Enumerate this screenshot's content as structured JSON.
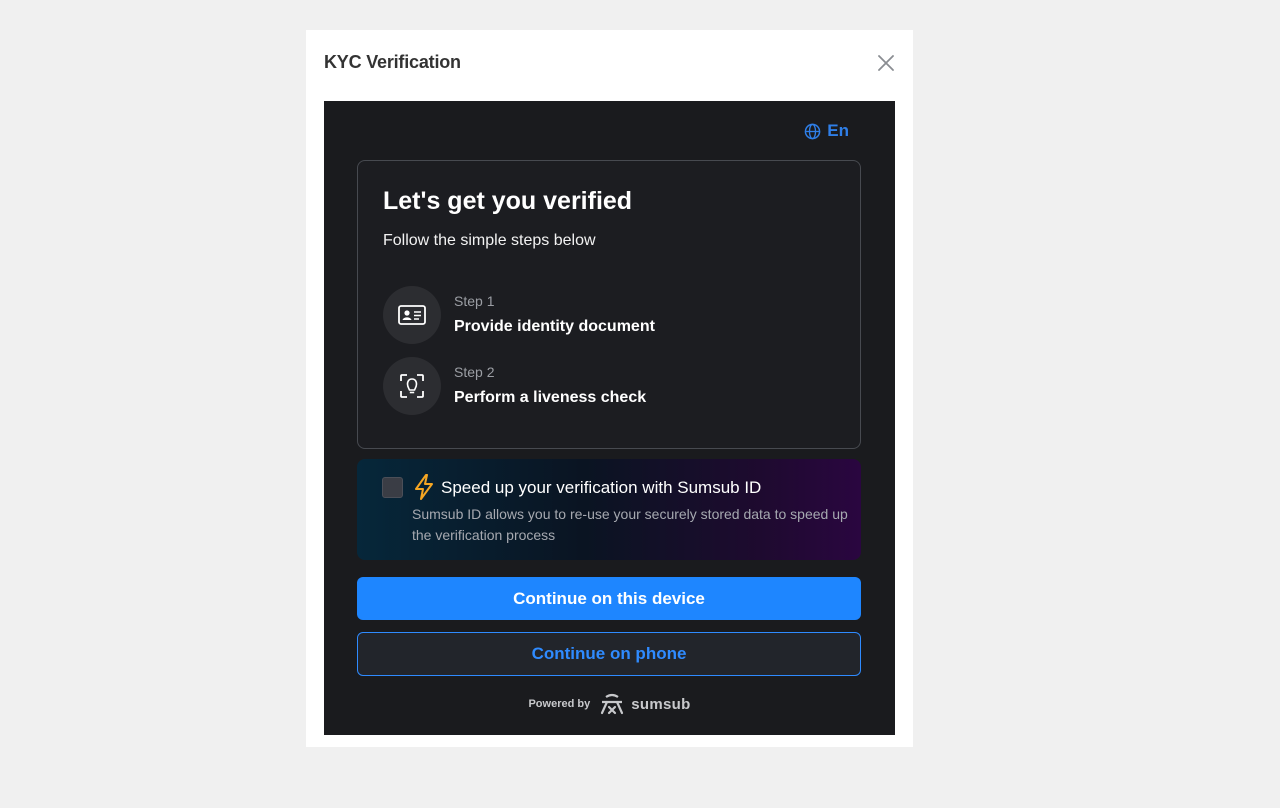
{
  "modal": {
    "title": "KYC Verification"
  },
  "language": {
    "label": "En",
    "icon": "globe-icon"
  },
  "intro": {
    "title": "Let's get you verified",
    "subtitle": "Follow the simple steps below"
  },
  "steps": [
    {
      "label": "Step 1",
      "text": "Provide identity document",
      "icon": "id-card-icon"
    },
    {
      "label": "Step 2",
      "text": "Perform a liveness check",
      "icon": "face-scan-icon"
    }
  ],
  "promo": {
    "title": "Speed up your verification with Sumsub ID",
    "description": "Sumsub ID allows you to re-use your securely stored data to speed up the verification process",
    "checked": false,
    "icon": "lightning-icon"
  },
  "actions": {
    "continue_device": "Continue on this device",
    "continue_phone": "Continue on phone"
  },
  "footer": {
    "powered_by": "Powered by",
    "brand": "sumsub"
  },
  "colors": {
    "accent": "#1e86ff",
    "panel_bg": "#1a1b1e",
    "page_bg": "#f0f0f0",
    "bolt": "#f5a623"
  }
}
